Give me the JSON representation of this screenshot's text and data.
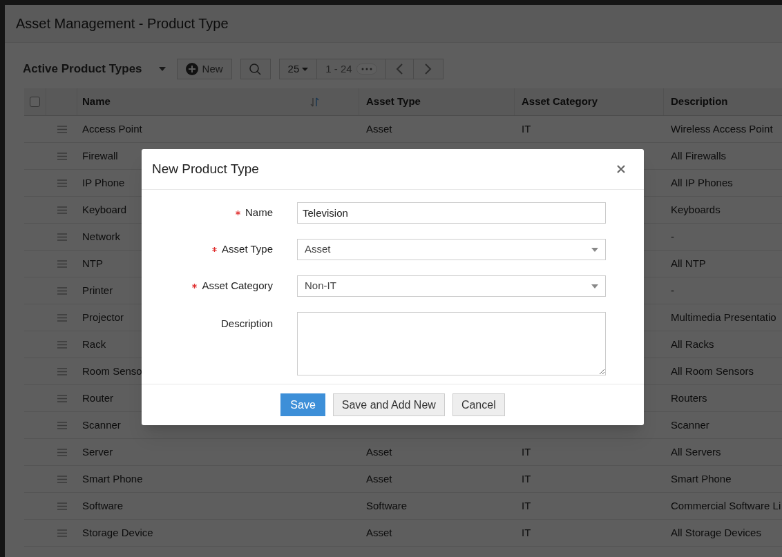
{
  "page_title": "Asset Management - Product Type",
  "toolbar": {
    "view": "Active Product Types",
    "new_button": "New",
    "page_size": "25",
    "range": "1 - 24"
  },
  "table": {
    "columns": [
      "Name",
      "Asset Type",
      "Asset Category",
      "Description"
    ],
    "rows": [
      {
        "name": "Access Point",
        "asset_type": "Asset",
        "asset_category": "IT",
        "description": "Wireless Access Point"
      },
      {
        "name": "Firewall",
        "description": "All Firewalls"
      },
      {
        "name": "IP Phone",
        "description": "All IP Phones"
      },
      {
        "name": "Keyboard",
        "description": "Keyboards"
      },
      {
        "name": "Network",
        "description": "-"
      },
      {
        "name": "NTP",
        "description": "All NTP"
      },
      {
        "name": "Printer",
        "description": "-"
      },
      {
        "name": "Projector",
        "description": "Multimedia Presentatio"
      },
      {
        "name": "Rack",
        "description": "All Racks"
      },
      {
        "name": "Room Senso",
        "description": "All Room Sensors"
      },
      {
        "name": "Router",
        "description": "Routers"
      },
      {
        "name": "Scanner",
        "description": "Scanner"
      },
      {
        "name": "Server",
        "asset_type": "Asset",
        "asset_category": "IT",
        "description": "All Servers"
      },
      {
        "name": "Smart Phone",
        "asset_type": "Asset",
        "asset_category": "IT",
        "description": "Smart Phone"
      },
      {
        "name": "Software",
        "asset_type": "Software",
        "asset_category": "IT",
        "description": "Commercial Software Li"
      },
      {
        "name": "Storage Device",
        "asset_type": "Asset",
        "asset_category": "IT",
        "description": "All Storage Devices"
      }
    ],
    "select_all_checked": false
  },
  "dialog": {
    "title": "New Product Type",
    "fields": [
      {
        "kind": "text",
        "label": "Name",
        "required": true,
        "value": "Television"
      },
      {
        "kind": "select",
        "label": "Asset Type",
        "required": true,
        "value": "Asset"
      },
      {
        "kind": "select",
        "label": "Asset Category",
        "required": true,
        "value": "Non-IT"
      },
      {
        "kind": "textarea",
        "label": "Description",
        "required": false
      }
    ],
    "buttons": [
      {
        "label": "Save",
        "primary": true
      },
      {
        "label": "Save and Add New",
        "primary": false
      },
      {
        "label": "Cancel",
        "primary": false
      }
    ]
  }
}
